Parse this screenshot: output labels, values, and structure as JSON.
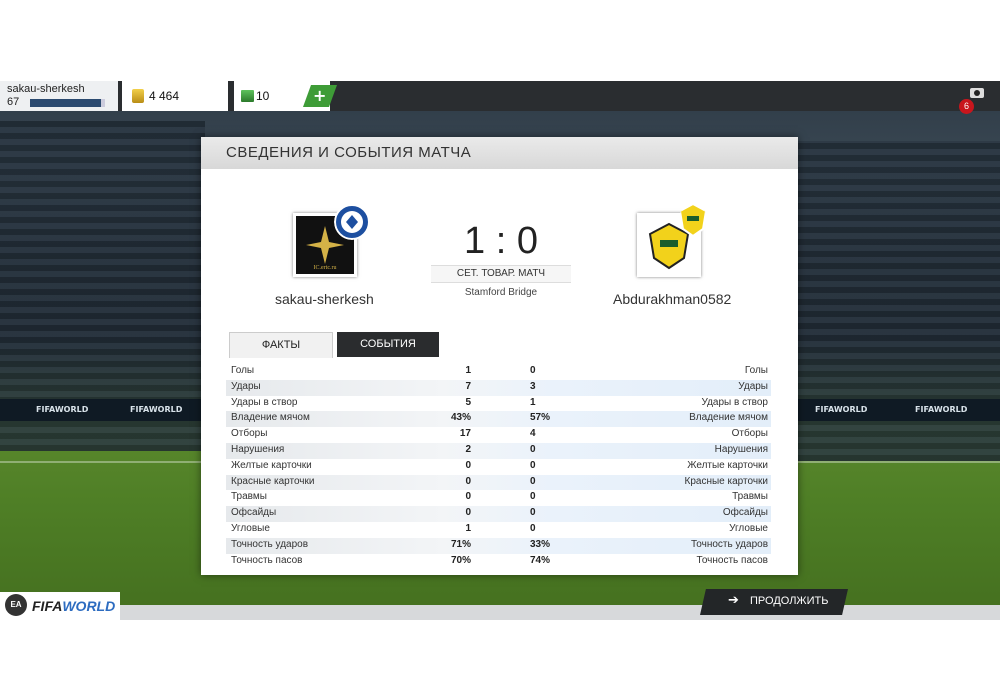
{
  "topbar": {
    "username": "sakau-sherkesh",
    "level": "67",
    "xp_progress": 0.95,
    "coins": "4 464",
    "points": "10",
    "plus_label": "+",
    "notifications": "6"
  },
  "panel": {
    "title": "СВЕДЕНИЯ И СОБЫТИЯ МАТЧА",
    "score": "1 : 0",
    "match_type": "СЕТ. ТОВАР. МАТЧ",
    "stadium": "Stamford Bridge",
    "home_team": "sakau-sherkesh",
    "away_team": "Abdurakhman0582",
    "home_crest_text": "IC.ertc.ru",
    "tabs": [
      "ФАКТЫ",
      "СОБЫТИЯ"
    ],
    "stats": [
      {
        "label": "Голы",
        "home": "1",
        "away": "0"
      },
      {
        "label": "Удары",
        "home": "7",
        "away": "3"
      },
      {
        "label": "Удары в створ",
        "home": "5",
        "away": "1"
      },
      {
        "label": "Владение мячом",
        "home": "43%",
        "away": "57%"
      },
      {
        "label": "Отборы",
        "home": "17",
        "away": "4"
      },
      {
        "label": "Нарушения",
        "home": "2",
        "away": "0"
      },
      {
        "label": "Желтые карточки",
        "home": "0",
        "away": "0"
      },
      {
        "label": "Красные карточки",
        "home": "0",
        "away": "0"
      },
      {
        "label": "Травмы",
        "home": "0",
        "away": "0"
      },
      {
        "label": "Офсайды",
        "home": "0",
        "away": "0"
      },
      {
        "label": "Угловые",
        "home": "1",
        "away": "0"
      },
      {
        "label": "Точность ударов",
        "home": "71%",
        "away": "33%"
      },
      {
        "label": "Точность пасов",
        "home": "70%",
        "away": "74%"
      }
    ]
  },
  "footer": {
    "ea_label": "EA",
    "fifa_word": "FIFA",
    "world_word": "WORLD",
    "continue_label": "ПРОДОЛЖИТЬ"
  },
  "background": {
    "board_text": "FIFAWORLD"
  }
}
